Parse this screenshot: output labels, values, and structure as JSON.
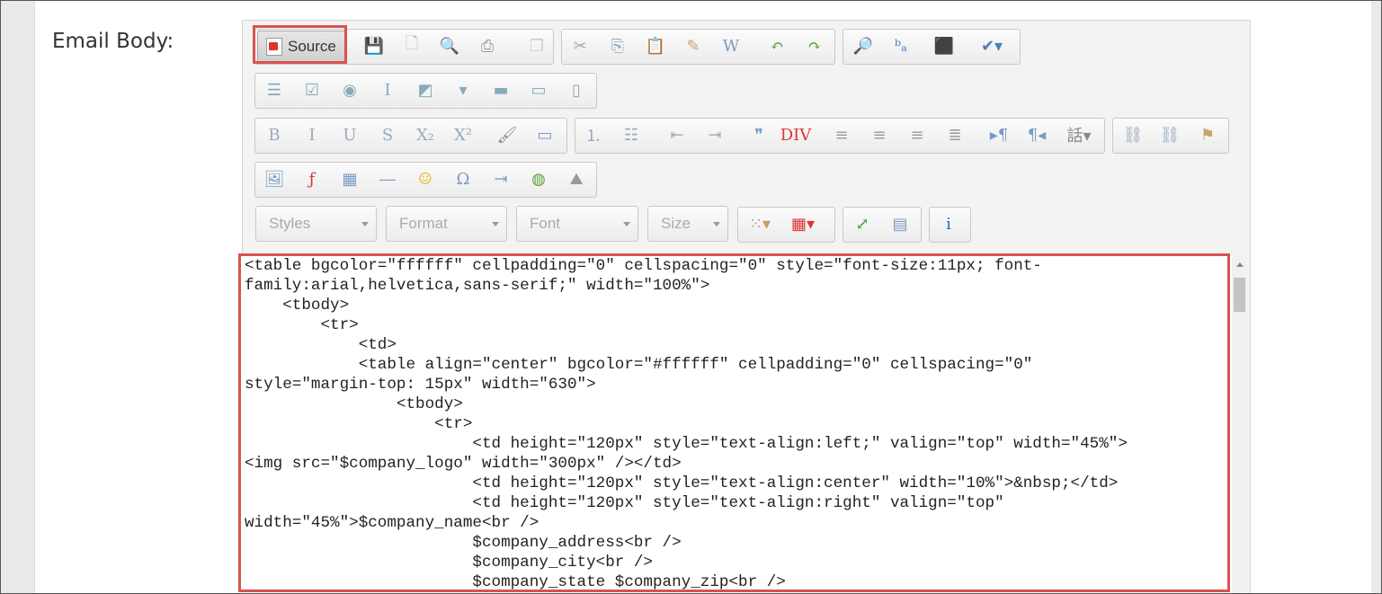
{
  "field": {
    "label": "Email Body:"
  },
  "toolbar": {
    "source_label": "Source",
    "row1": [
      {
        "name": "save-icon",
        "glyph": "💾"
      },
      {
        "name": "new-page-icon",
        "glyph": "🗋"
      },
      {
        "name": "preview-icon",
        "glyph": "🔍"
      },
      {
        "name": "print-icon",
        "glyph": "⎙"
      },
      {
        "name": "templates-icon",
        "glyph": "❐"
      },
      {
        "name": "cut-icon",
        "glyph": "✂"
      },
      {
        "name": "copy-icon",
        "glyph": "⎘"
      },
      {
        "name": "paste-icon",
        "glyph": "📋"
      },
      {
        "name": "paste-text-icon",
        "glyph": "✎"
      },
      {
        "name": "paste-word-icon",
        "glyph": "W"
      },
      {
        "name": "undo-icon",
        "glyph": "↶"
      },
      {
        "name": "redo-icon",
        "glyph": "↷"
      },
      {
        "name": "find-icon",
        "glyph": "🔎"
      },
      {
        "name": "replace-icon",
        "glyph": "ᵇₐ"
      },
      {
        "name": "select-all-icon",
        "glyph": "⬛"
      },
      {
        "name": "spellcheck-icon",
        "glyph": "✔▾"
      }
    ],
    "row2": [
      {
        "name": "form-icon",
        "glyph": "☰"
      },
      {
        "name": "checkbox-icon",
        "glyph": "☑"
      },
      {
        "name": "radio-icon",
        "glyph": "◉"
      },
      {
        "name": "textfield-icon",
        "glyph": "I"
      },
      {
        "name": "textarea-icon",
        "glyph": "◩"
      },
      {
        "name": "select-icon",
        "glyph": "▾"
      },
      {
        "name": "button-icon",
        "glyph": "▬"
      },
      {
        "name": "image-button-icon",
        "glyph": "▭"
      },
      {
        "name": "hidden-field-icon",
        "glyph": "▯"
      }
    ],
    "row3": [
      {
        "name": "bold-icon",
        "glyph": "B"
      },
      {
        "name": "italic-icon",
        "glyph": "I"
      },
      {
        "name": "underline-icon",
        "glyph": "U"
      },
      {
        "name": "strike-icon",
        "glyph": "S"
      },
      {
        "name": "subscript-icon",
        "glyph": "X₂"
      },
      {
        "name": "superscript-icon",
        "glyph": "X²"
      },
      {
        "name": "remove-format-icon",
        "glyph": "🖌"
      },
      {
        "name": "copy-format-icon",
        "glyph": "▭"
      },
      {
        "name": "numbered-list-icon",
        "glyph": "⒈"
      },
      {
        "name": "bulleted-list-icon",
        "glyph": "☷"
      },
      {
        "name": "outdent-icon",
        "glyph": "⇤"
      },
      {
        "name": "indent-icon",
        "glyph": "⇥"
      },
      {
        "name": "blockquote-icon",
        "glyph": "❞"
      },
      {
        "name": "div-icon",
        "glyph": "DIV"
      },
      {
        "name": "align-left-icon",
        "glyph": "≡"
      },
      {
        "name": "align-center-icon",
        "glyph": "≡"
      },
      {
        "name": "align-right-icon",
        "glyph": "≡"
      },
      {
        "name": "justify-icon",
        "glyph": "≣"
      },
      {
        "name": "ltr-icon",
        "glyph": "▸¶"
      },
      {
        "name": "rtl-icon",
        "glyph": "¶◂"
      },
      {
        "name": "language-icon",
        "glyph": "話▾"
      },
      {
        "name": "link-icon",
        "glyph": "⛓"
      },
      {
        "name": "unlink-icon",
        "glyph": "⛓"
      },
      {
        "name": "anchor-icon",
        "glyph": "⚑"
      }
    ],
    "row4": [
      {
        "name": "image-icon",
        "glyph": "🖼"
      },
      {
        "name": "flash-icon",
        "glyph": "ƒ"
      },
      {
        "name": "table-icon",
        "glyph": "▦"
      },
      {
        "name": "horizontal-rule-icon",
        "glyph": "―"
      },
      {
        "name": "smiley-icon",
        "glyph": "☺"
      },
      {
        "name": "special-char-icon",
        "glyph": "Ω"
      },
      {
        "name": "page-break-icon",
        "glyph": "⇥"
      },
      {
        "name": "iframe-icon",
        "glyph": "◍"
      },
      {
        "name": "template-image-icon",
        "glyph": "⛰"
      }
    ],
    "combos": [
      {
        "name": "styles-combo",
        "label": "Styles"
      },
      {
        "name": "format-combo",
        "label": "Format"
      },
      {
        "name": "font-combo",
        "label": "Font"
      },
      {
        "name": "size-combo",
        "label": "Size"
      }
    ],
    "row5": [
      {
        "name": "text-color-icon",
        "glyph": "⁙▾"
      },
      {
        "name": "bg-color-icon",
        "glyph": "▦▾"
      },
      {
        "name": "maximize-icon",
        "glyph": "⤢"
      },
      {
        "name": "show-blocks-icon",
        "glyph": "▤"
      },
      {
        "name": "about-icon",
        "glyph": "i"
      }
    ]
  },
  "source_code": [
    "<table bgcolor=\"ffffff\" cellpadding=\"0\" cellspacing=\"0\" style=\"font-size:11px; font-",
    "family:arial,helvetica,sans-serif;\" width=\"100%\">",
    "    <tbody>",
    "        <tr>",
    "            <td>",
    "            <table align=\"center\" bgcolor=\"#ffffff\" cellpadding=\"0\" cellspacing=\"0\"",
    "style=\"margin-top: 15px\" width=\"630\">",
    "                <tbody>",
    "                    <tr>",
    "                        <td height=\"120px\" style=\"text-align:left;\" valign=\"top\" width=\"45%\">",
    "<img src=\"$company_logo\" width=\"300px\" /></td>",
    "                        <td height=\"120px\" style=\"text-align:center\" width=\"10%\">&nbsp;</td>",
    "                        <td height=\"120px\" style=\"text-align:right\" valign=\"top\"",
    "width=\"45%\">$company_name<br />",
    "                        $company_address<br />",
    "                        $company_city<br />",
    "                        $company_state $company_zip<br />"
  ],
  "colors": {
    "highlight": "#d9534f",
    "panel": "#f3f3f3"
  }
}
